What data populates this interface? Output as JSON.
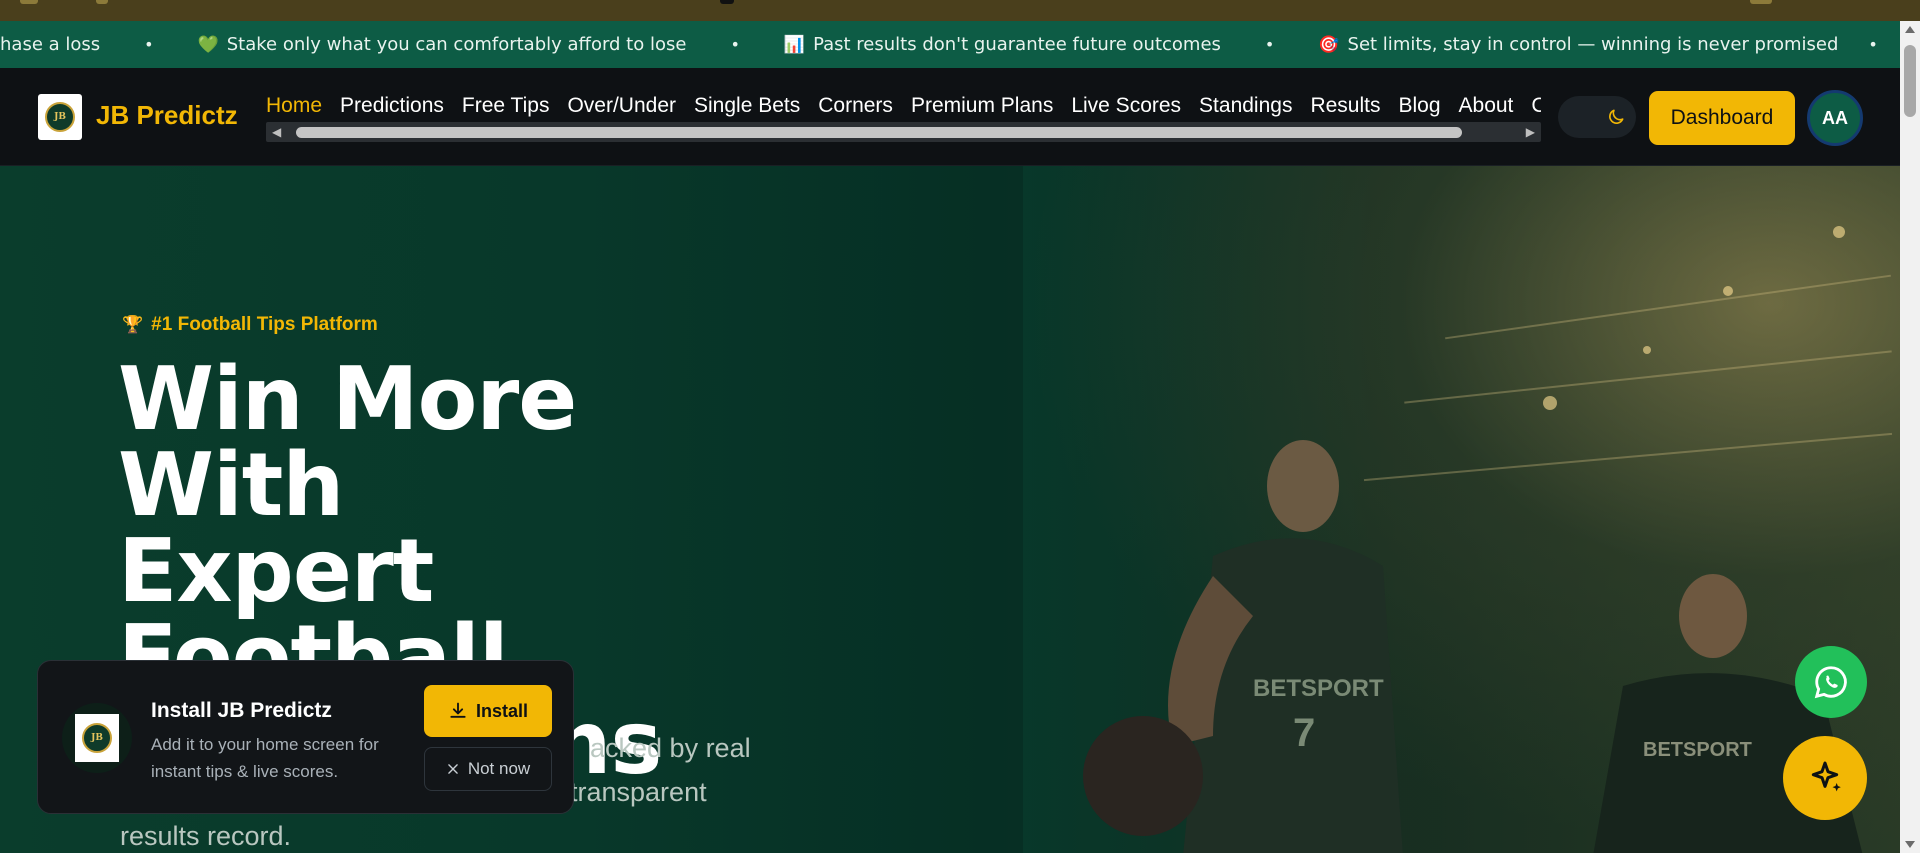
{
  "ticker": {
    "items": [
      {
        "emoji": "",
        "text": "hase a loss"
      },
      {
        "emoji": "💚",
        "text": "Stake only what you can comfortably afford to lose"
      },
      {
        "emoji": "📊",
        "text": "Past results don't guarantee future outcomes"
      },
      {
        "emoji": "🎯",
        "text": "Set limits, stay in control — winning is never promised"
      }
    ],
    "separator": "•"
  },
  "navbar": {
    "brand": "JB Predictz",
    "logo_text": "JB",
    "links": [
      "Home",
      "Predictions",
      "Free Tips",
      "Over/Under",
      "Single Bets",
      "Corners",
      "Premium Plans",
      "Live Scores",
      "Standings",
      "Results",
      "Blog",
      "About",
      "Co"
    ],
    "active_link": "Home",
    "dashboard_label": "Dashboard",
    "avatar_initials": "AA",
    "theme_icon": "moon-icon"
  },
  "hero": {
    "badge": "#1 Football Tips Platform",
    "title_lines": [
      "Win More With",
      "Expert",
      "Football",
      "Predictions"
    ],
    "subtitle_visible": [
      "acked by real",
      "transparent",
      "results record."
    ]
  },
  "install_prompt": {
    "title": "Install JB Predictz",
    "description": "Add it to your home screen for instant tips & live scores.",
    "install_label": "Install",
    "not_now_label": "Not now"
  },
  "colors": {
    "accent": "#f2b705",
    "ticker_bg": "#0d5c45",
    "navbar_bg": "#0e1114",
    "whatsapp": "#22c05a"
  }
}
